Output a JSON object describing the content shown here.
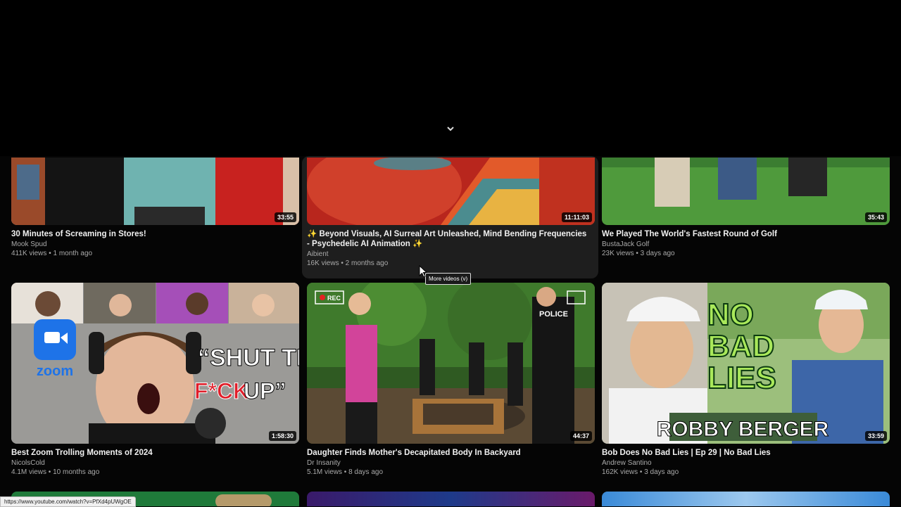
{
  "collapse_icon": "chevron-down-icon",
  "videos_row1": [
    {
      "title": "30 Minutes of Screaming in Stores!",
      "channel": "Mook Spud",
      "views": "411K views",
      "age": "1 month ago",
      "duration": "33:55"
    },
    {
      "title": "✨ Beyond Visuals, AI Surreal Art Unleashed, Mind Bending Frequencies - Psychedelic AI Animation ✨",
      "channel": "Aibient",
      "views": "16K views",
      "age": "2 months ago",
      "duration": "11:11:03"
    },
    {
      "title": "We Played The World's Fastest Round of Golf",
      "channel": "BustaJack Golf",
      "views": "23K views",
      "age": "3 days ago",
      "duration": "35:43"
    }
  ],
  "videos_row2": [
    {
      "title": "Best Zoom Trolling Moments of 2024",
      "channel": "NicolsCold",
      "views": "4.1M views",
      "age": "10 months ago",
      "duration": "1:58:30",
      "thumb_text_1": "“SHUT THE",
      "thumb_text_2": "F*CK",
      "thumb_text_3": "UP”",
      "logo_text": "zoom"
    },
    {
      "title": "Daughter Finds Mother's Decapitated Body In Backyard",
      "channel": "Dr Insanity",
      "views": "5.1M views",
      "age": "8 days ago",
      "duration": "44:37",
      "thumb_text_1": "REC",
      "thumb_text_2": "POLICE"
    },
    {
      "title": "Bob Does No Bad Lies | Ep 29 | No Bad Lies",
      "channel": "Andrew Santino",
      "views": "162K views",
      "age": "3 days ago",
      "duration": "33:59",
      "thumb_text_1": "NO",
      "thumb_text_2": "BAD",
      "thumb_text_3": "LIES",
      "thumb_text_4": "ROBBY BERGER"
    }
  ],
  "separator": "•",
  "tooltip": "More videos (v)",
  "status_url": "https://www.youtube.com/watch?v=PfXd4pUWgOE",
  "colors": {
    "background": "#000000",
    "title": "#f1f1f1",
    "meta": "#aaaaaa",
    "hover_card": "#1e1e1e"
  }
}
